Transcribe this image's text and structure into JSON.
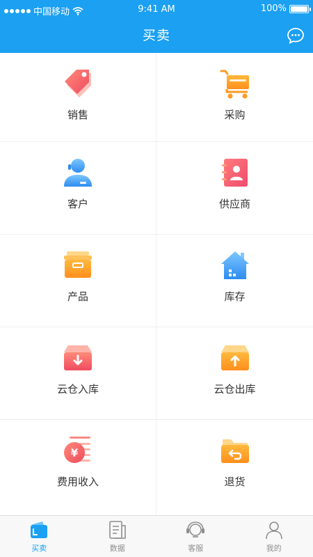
{
  "status": {
    "carrier": "中国移动",
    "time": "9:41 AM",
    "battery": "100%"
  },
  "nav": {
    "title": "买卖",
    "right_icon": "chat-bubble-icon"
  },
  "grid": {
    "items": [
      {
        "label": "销售",
        "icon": "price-tag-icon"
      },
      {
        "label": "采购",
        "icon": "shopping-cart-icon"
      },
      {
        "label": "客户",
        "icon": "customer-icon"
      },
      {
        "label": "供应商",
        "icon": "supplier-book-icon"
      },
      {
        "label": "产品",
        "icon": "product-box-icon"
      },
      {
        "label": "库存",
        "icon": "warehouse-house-icon"
      },
      {
        "label": "云仓入库",
        "icon": "inbound-box-icon"
      },
      {
        "label": "云仓出库",
        "icon": "outbound-box-icon"
      },
      {
        "label": "费用收入",
        "icon": "yuan-coin-icon"
      },
      {
        "label": "退货",
        "icon": "return-folder-icon"
      }
    ]
  },
  "tabbar": {
    "items": [
      {
        "label": "买卖",
        "icon": "wallet-icon",
        "active": true
      },
      {
        "label": "数据",
        "icon": "document-icon",
        "active": false
      },
      {
        "label": "客服",
        "icon": "headset-icon",
        "active": false
      },
      {
        "label": "我的",
        "icon": "person-icon",
        "active": false
      }
    ]
  },
  "colors": {
    "accent": "#1ba0f2",
    "text": "#333333",
    "tab_inactive": "#8e8e8e",
    "orange": "#ffa318",
    "red": "#f05a5a"
  }
}
